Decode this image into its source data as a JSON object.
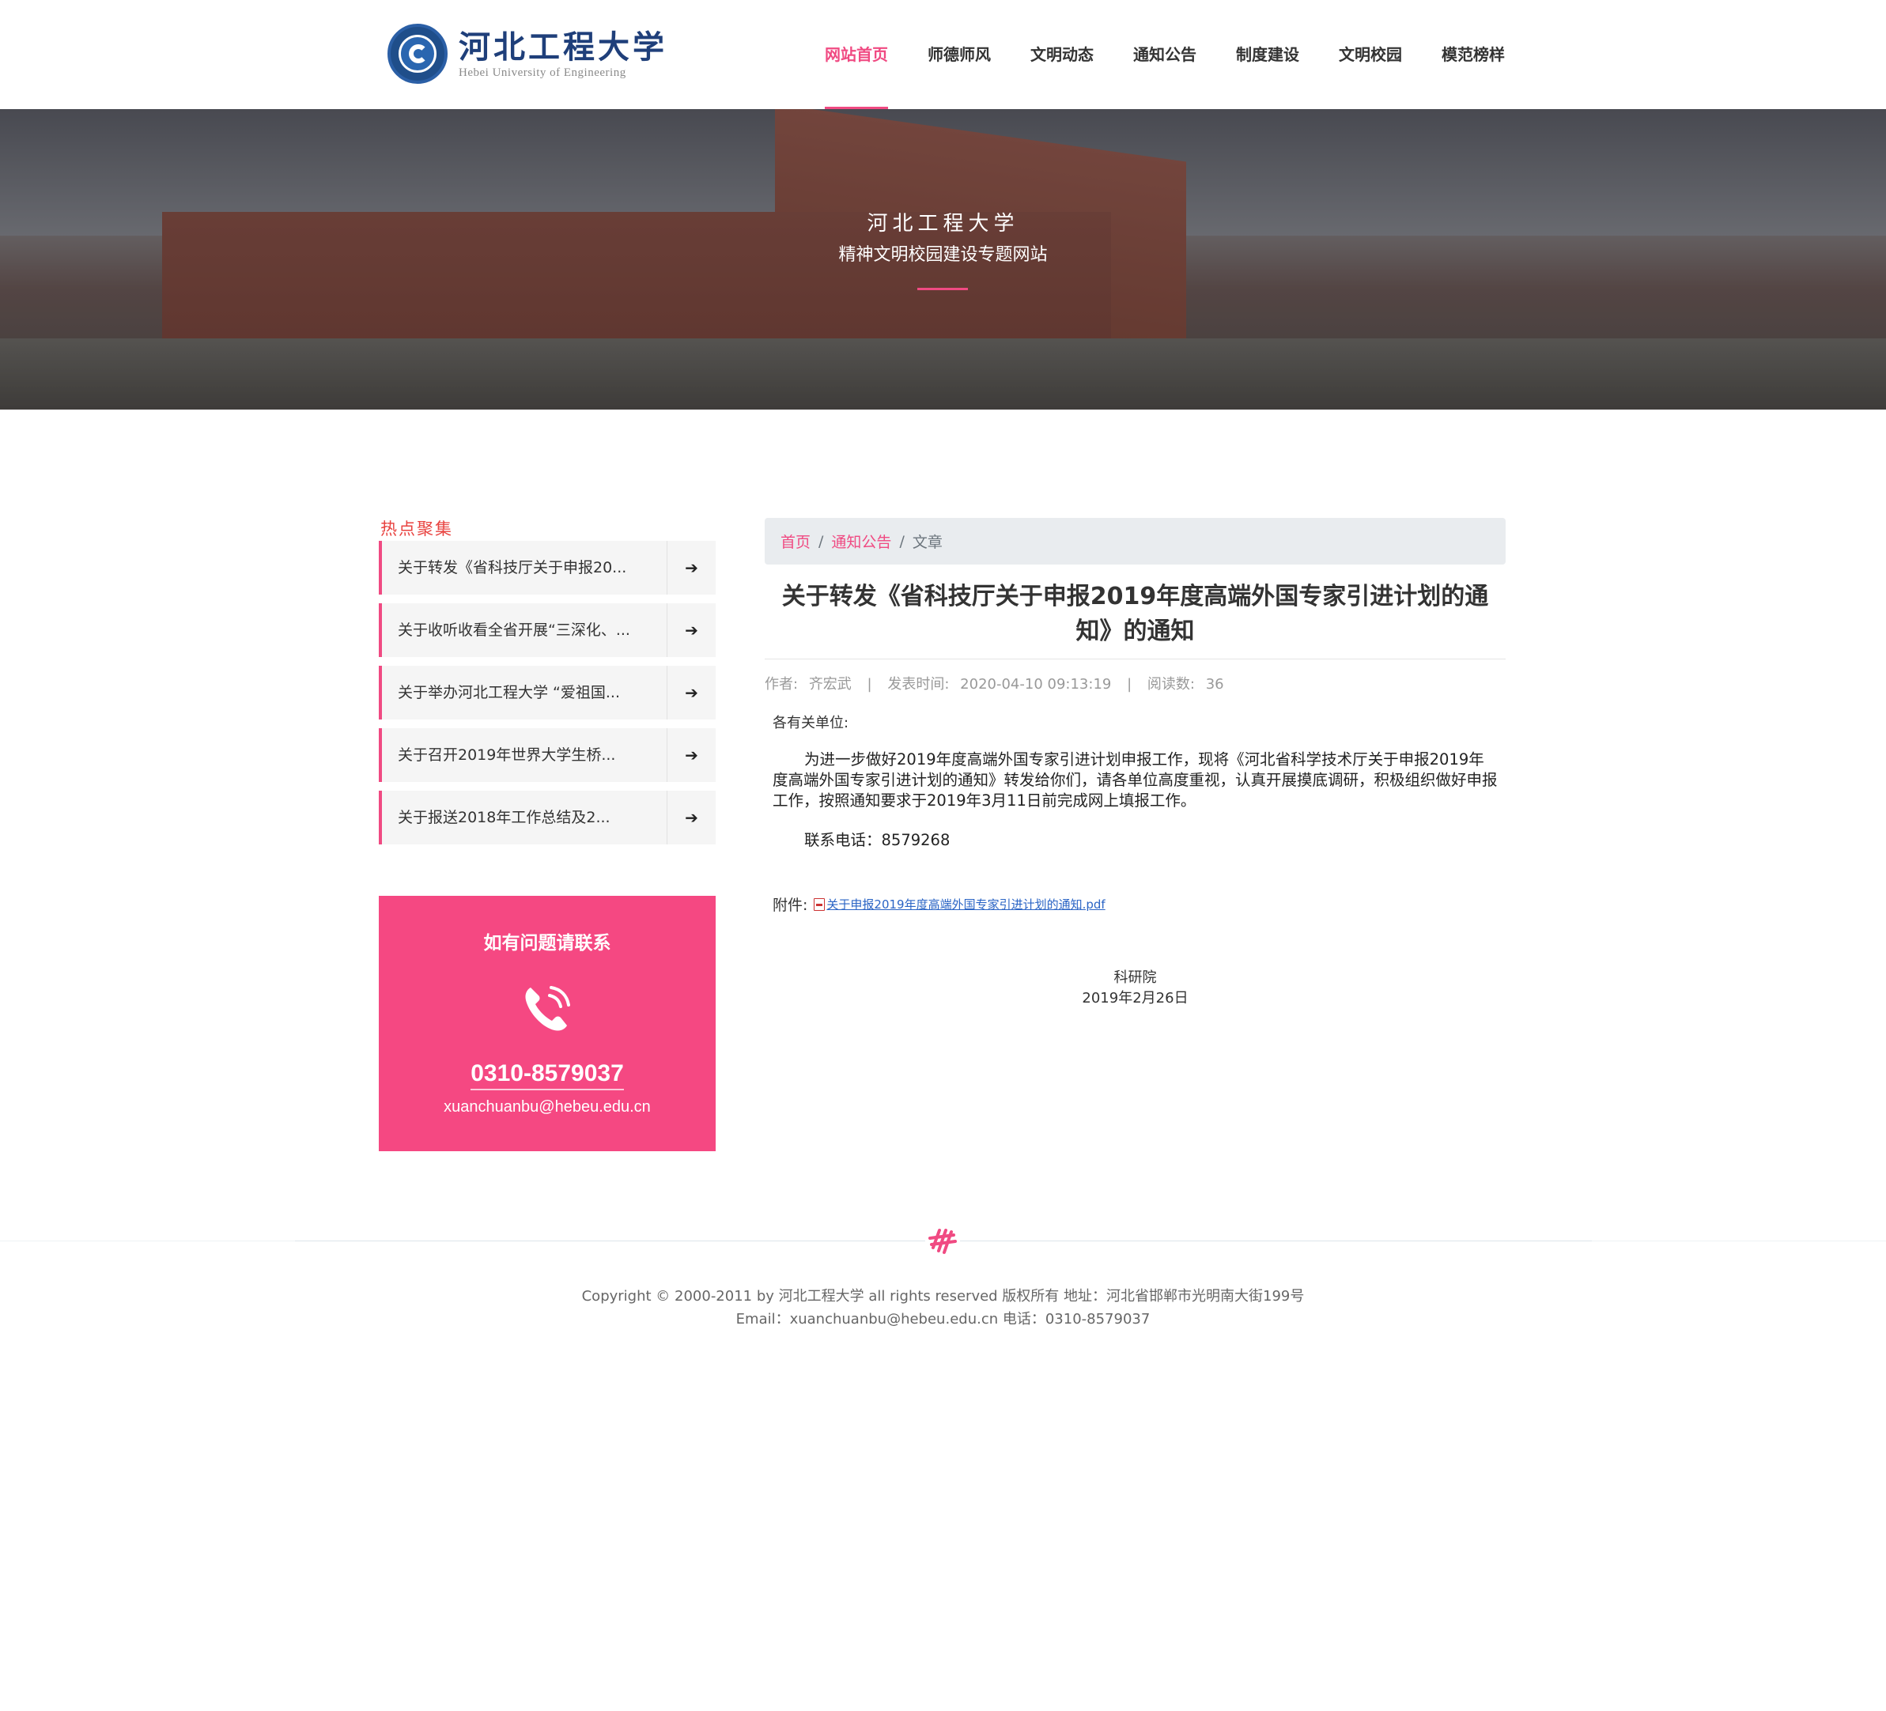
{
  "header": {
    "logo_cn": "河北工程大学",
    "logo_en": "Hebei University of Engineering",
    "nav": [
      {
        "label": "网站首页",
        "active": true
      },
      {
        "label": "师德师风",
        "active": false
      },
      {
        "label": "文明动态",
        "active": false
      },
      {
        "label": "通知公告",
        "active": false
      },
      {
        "label": "制度建设",
        "active": false
      },
      {
        "label": "文明校园",
        "active": false
      },
      {
        "label": "模范榜样",
        "active": false
      }
    ]
  },
  "banner": {
    "title": "河北工程大学",
    "subtitle": "精神文明校园建设专题网站"
  },
  "sidebar": {
    "hot_title": "热点聚集",
    "hot_items": [
      {
        "label": "关于转发《省科技厅关于申报20..."
      },
      {
        "label": "关于收听收看全省开展“三深化、..."
      },
      {
        "label": "关于举办河北工程大学 “爱祖国..."
      },
      {
        "label": "关于召开2019年世界大学生桥..."
      },
      {
        "label": "关于报送2018年工作总结及2..."
      }
    ],
    "contact": {
      "heading": "如有问题请联系",
      "phone": "0310-8579037",
      "email": "xuanchuanbu@hebeu.edu.cn"
    }
  },
  "breadcrumb": {
    "home": "首页",
    "section": "通知公告",
    "current": "文章",
    "separator": "/"
  },
  "article": {
    "title": "关于转发《省科技厅关于申报2019年度高端外国专家引进计划的通知》的通知",
    "meta": {
      "author_label": "作者:",
      "author": "齐宏武",
      "date_label": "发表时间:",
      "date": "2020-04-10 09:13:19",
      "views_label": "阅读数:",
      "views": "36",
      "divider": "|"
    },
    "greeting": "各有关单位:",
    "body": "为进一步做好2019年度高端外国专家引进计划申报工作，现将《河北省科学技术厅关于申报2019年度高端外国专家引进计划的通知》转发给你们，请各单位高度重视，认真开展摸底调研，积极组织做好申报工作，按照通知要求于2019年3月11日前完成网上填报工作。",
    "tel": "联系电话：8579268",
    "attachment_label": "附件:",
    "attachment_link": "关于申报2019年度高端外国专家引进计划的通知.pdf",
    "sign_org": "科研院",
    "sign_date": "2019年2月26日"
  },
  "footer": {
    "line1": "Copyright © 2000-2011 by 河北工程大学 all rights reserved 版权所有 地址：河北省邯郸市光明南大街199号",
    "line2": "Email：xuanchuanbu@hebeu.edu.cn 电话：0310-8579037"
  },
  "colors": {
    "accent": "#f04a82",
    "contact_bg": "#f54882",
    "hot_title": "#e8423f",
    "link": "#2a64c5"
  },
  "icons": [
    "university-seal-icon",
    "arrow-right-icon",
    "phone-icon",
    "pdf-icon",
    "footer-ornament-icon"
  ]
}
